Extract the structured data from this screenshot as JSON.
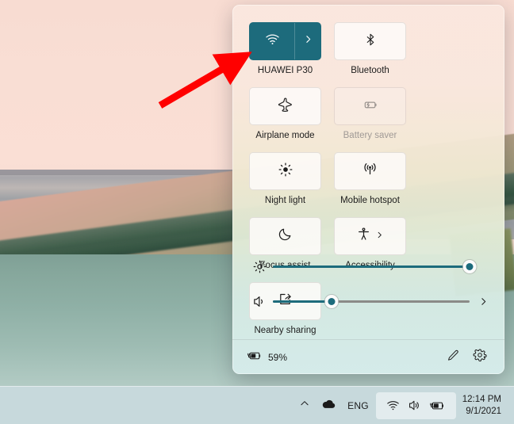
{
  "quick_settings": {
    "tiles": [
      {
        "label": "HUAWEI P30",
        "icon": "wifi-icon",
        "state": "on",
        "has_chevron": true
      },
      {
        "label": "Bluetooth",
        "icon": "bluetooth-icon",
        "state": "off",
        "has_chevron": false
      },
      {
        "label": "Airplane mode",
        "icon": "airplane-icon",
        "state": "off",
        "has_chevron": false
      },
      {
        "label": "Battery saver",
        "icon": "battery-saver-icon",
        "state": "disabled",
        "has_chevron": false
      },
      {
        "label": "Night light",
        "icon": "brightness-icon",
        "state": "off",
        "has_chevron": false
      },
      {
        "label": "Mobile hotspot",
        "icon": "hotspot-icon",
        "state": "off",
        "has_chevron": false
      },
      {
        "label": "Focus assist",
        "icon": "moon-icon",
        "state": "off",
        "has_chevron": false
      },
      {
        "label": "Accessibility",
        "icon": "accessibility-icon",
        "state": "off",
        "has_chevron": true
      },
      {
        "label": "Nearby sharing",
        "icon": "share-icon",
        "state": "off",
        "has_chevron": false
      }
    ],
    "sliders": [
      {
        "name": "brightness",
        "icon": "brightness-icon",
        "value": 100,
        "has_chevron": false
      },
      {
        "name": "volume",
        "icon": "volume-icon",
        "value": 30,
        "has_chevron": true
      }
    ],
    "footer": {
      "battery_icon": "battery-charging-icon",
      "battery_text": "59%",
      "edit_label": "edit-quick-settings",
      "settings_label": "open-settings"
    },
    "accent_color": "#1D6B7C"
  },
  "taskbar": {
    "show_hidden_icons": "chevron-up-icon",
    "onedrive_icon": "cloud-icon",
    "language": "ENG",
    "tray_icons": [
      "wifi-icon",
      "volume-icon",
      "battery-charging-icon"
    ],
    "clock": {
      "time": "12:14 PM",
      "date": "9/1/2021"
    }
  },
  "annotation": {
    "arrow_color": "#FF0000",
    "points_to": "HUAWEI P30"
  }
}
